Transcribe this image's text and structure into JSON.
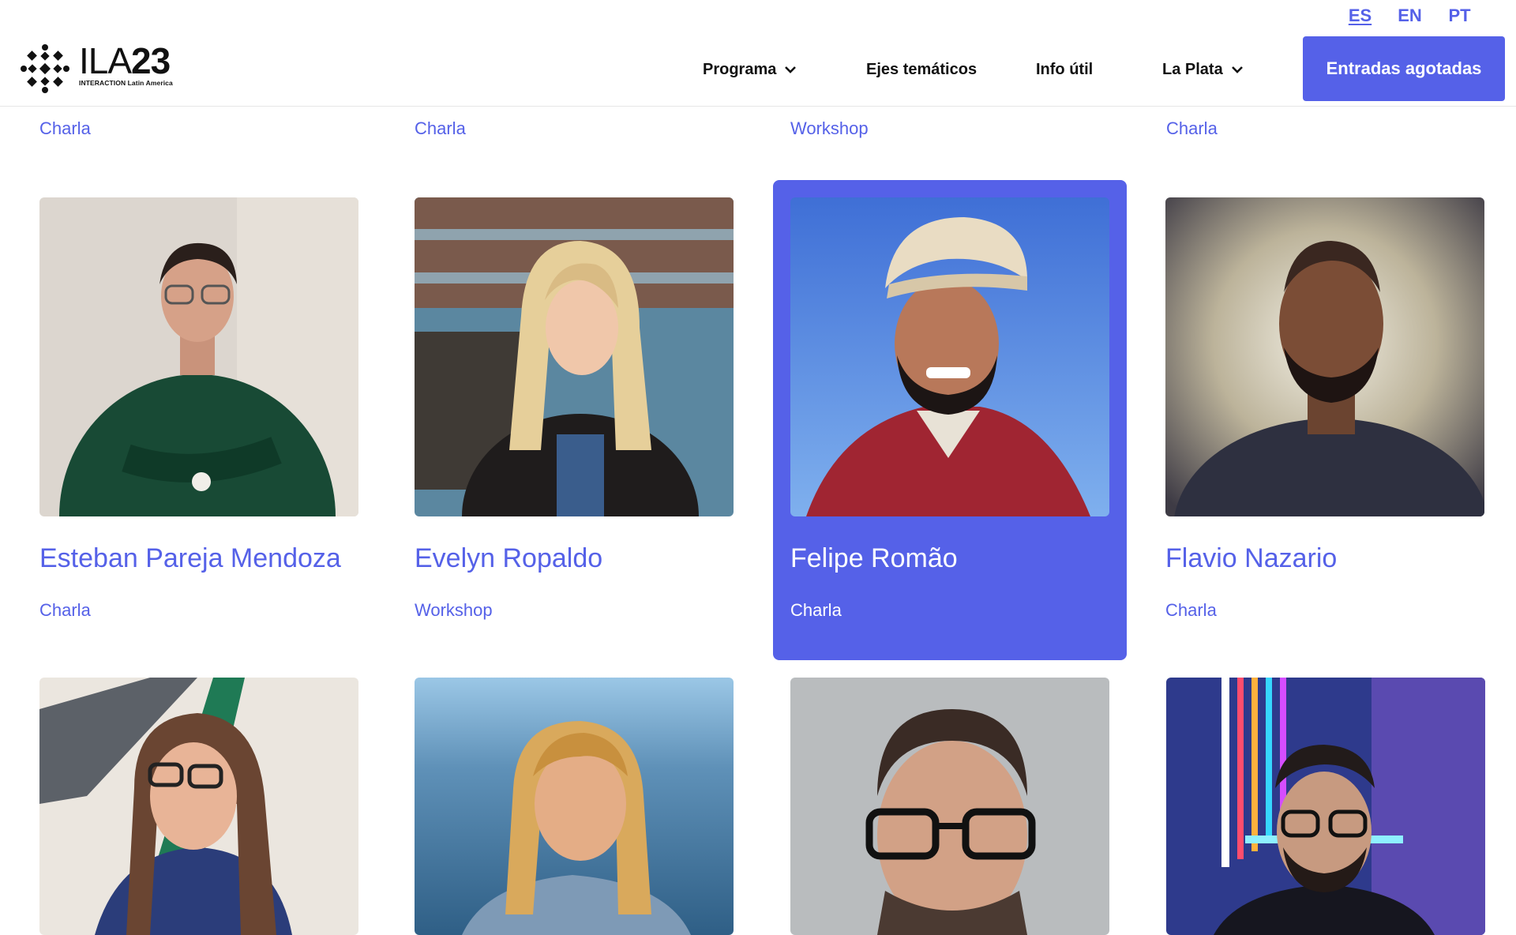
{
  "languages": [
    {
      "code": "ES",
      "active": true
    },
    {
      "code": "EN",
      "active": false
    },
    {
      "code": "PT",
      "active": false
    }
  ],
  "logo": {
    "title_light": "ILA",
    "title_bold": "23",
    "subtitle": "INTERACTION Latin America"
  },
  "nav": {
    "items": [
      {
        "label": "Programa",
        "has_dropdown": true
      },
      {
        "label": "Ejes temáticos",
        "has_dropdown": false
      },
      {
        "label": "Info útil",
        "has_dropdown": false
      },
      {
        "label": "La Plata",
        "has_dropdown": true
      }
    ],
    "cta_label": "Entradas agotadas"
  },
  "partial_row": [
    "Charla",
    "Charla",
    "Workshop",
    "Charla"
  ],
  "speakers": [
    {
      "name": "Esteban Pareja Mendoza",
      "type": "Charla",
      "highlighted": false
    },
    {
      "name": "Evelyn Ropaldo",
      "type": "Workshop",
      "highlighted": false
    },
    {
      "name": "Felipe Romão",
      "type": "Charla",
      "highlighted": true
    },
    {
      "name": "Flavio Nazario",
      "type": "Charla",
      "highlighted": false
    }
  ],
  "next_row_count": 4,
  "colors": {
    "accent": "#5561e8",
    "text": "#111111",
    "background": "#ffffff"
  }
}
